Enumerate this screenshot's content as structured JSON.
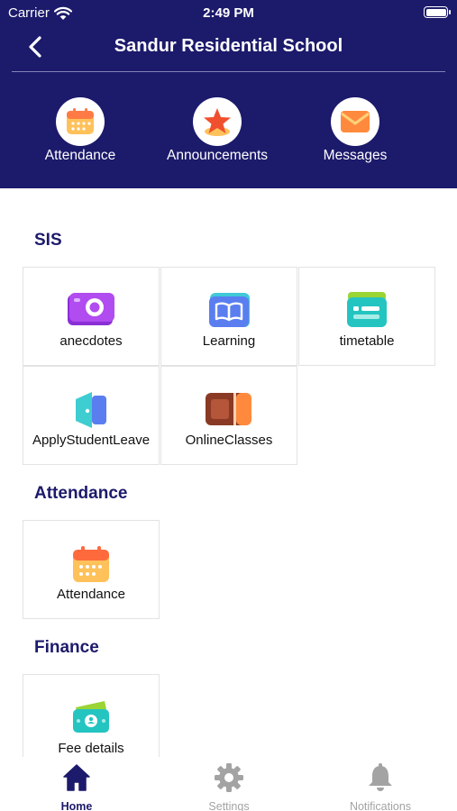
{
  "status_bar": {
    "carrier": "Carrier",
    "time": "2:49 PM"
  },
  "header": {
    "title": "Sandur Residential School"
  },
  "quick_actions": [
    {
      "label": "Attendance",
      "icon": "calendar-icon"
    },
    {
      "label": "Announcements",
      "icon": "star-icon"
    },
    {
      "label": "Messages",
      "icon": "envelope-icon"
    }
  ],
  "sections": {
    "sis": {
      "title": "SIS",
      "tiles": [
        {
          "label": "anecdotes",
          "icon": "camera-icon"
        },
        {
          "label": "Learning",
          "icon": "book-icon"
        },
        {
          "label": "timetable",
          "icon": "timetable-icon"
        },
        {
          "label": "ApplyStudentLeave",
          "icon": "door-icon"
        },
        {
          "label": "OnlineClasses",
          "icon": "online-class-icon"
        }
      ]
    },
    "attendance": {
      "title": "Attendance",
      "tiles": [
        {
          "label": "Attendance",
          "icon": "calendar-icon"
        }
      ]
    },
    "finance": {
      "title": "Finance",
      "tiles": [
        {
          "label": "Fee details",
          "icon": "money-icon"
        }
      ]
    }
  },
  "tabbar": {
    "active": "Home",
    "tabs": [
      {
        "label": "Home",
        "icon": "home-icon"
      },
      {
        "label": "Settings",
        "icon": "gear-icon"
      },
      {
        "label": "Notifications",
        "icon": "bell-icon"
      }
    ]
  },
  "colors": {
    "header_bg": "#1c1a6b",
    "accent_navy": "#1c1a6b",
    "tab_inactive": "#a3a3a3"
  }
}
